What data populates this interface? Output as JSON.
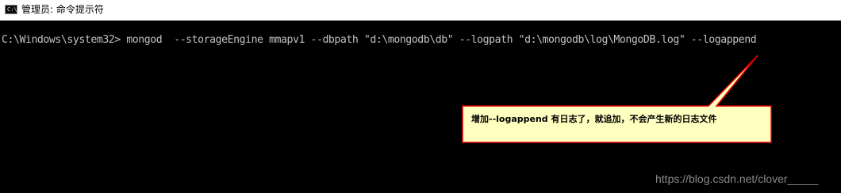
{
  "window": {
    "title": "管理员: 命令提示符",
    "icon": "console-icon",
    "icon_glyph": "C:\\"
  },
  "console": {
    "prompt": "C:\\Windows\\system32>",
    "command": " mongod  --storageEngine mmapv1 --dbpath \"d:\\mongodb\\db\" --logpath \"d:\\mongodb\\log\\MongoDB.log\" --logappend"
  },
  "annotation": {
    "text": "增加--logappend 有日志了，就追加，不会产生新的日志文件",
    "fill": "#ffffc0",
    "border": "#e00000"
  },
  "watermark": {
    "text": "https://blog.csdn.net/clover_____"
  }
}
